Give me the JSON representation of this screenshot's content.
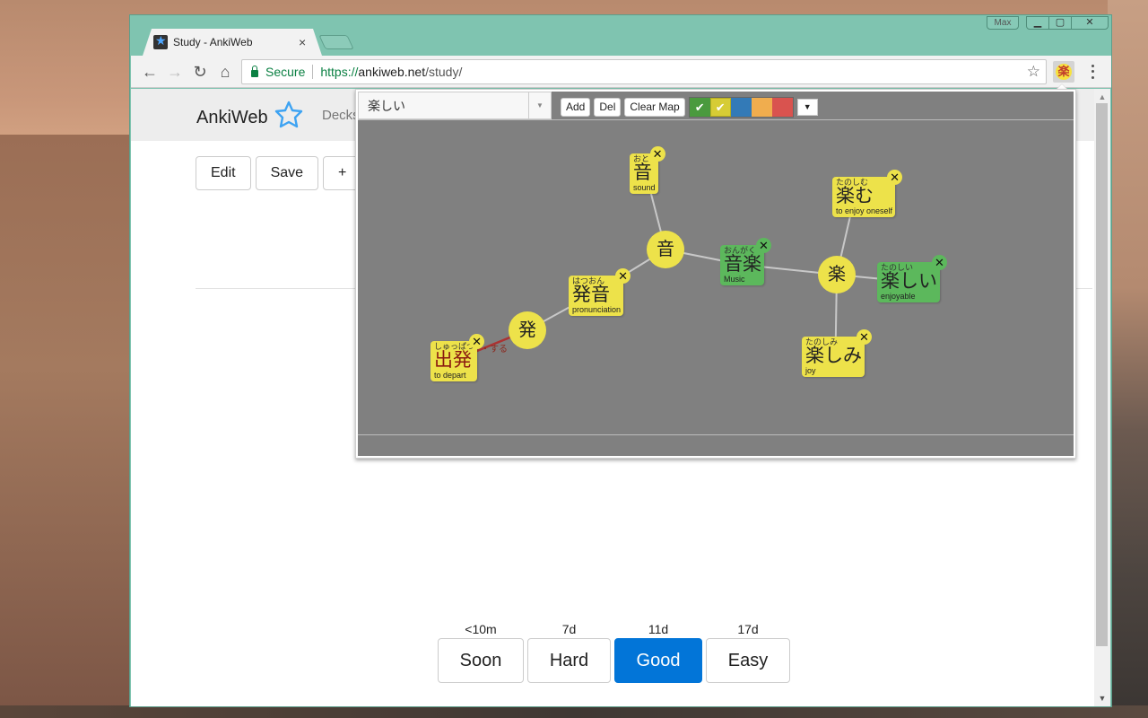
{
  "window": {
    "max_label": "Max",
    "controls": [
      "minimize",
      "restore",
      "close"
    ]
  },
  "tab": {
    "title": "Study - AnkiWeb",
    "close_glyph": "×"
  },
  "toolbar": {
    "back_glyph": "←",
    "forward_glyph": "→",
    "reload_glyph": "↻",
    "home_glyph": "⌂",
    "secure_label": "Secure",
    "url_scheme": "https://",
    "url_host": "ankiweb.net",
    "url_path": "/study/",
    "star_glyph": "☆",
    "extension_glyph": "楽"
  },
  "page": {
    "brand": "AnkiWeb",
    "brand_star": "✩",
    "nav_decks": "Decks",
    "edit_buttons": [
      "Edit",
      "Save",
      "+"
    ],
    "answers": [
      {
        "time": "<10m",
        "label": "Soon",
        "primary": false
      },
      {
        "time": "7d",
        "label": "Hard",
        "primary": false
      },
      {
        "time": "11d",
        "label": "Good",
        "primary": true
      },
      {
        "time": "17d",
        "label": "Easy",
        "primary": false
      }
    ]
  },
  "popup": {
    "selected_word": "楽しい",
    "select_arrow": "▼",
    "buttons": {
      "add": "Add",
      "del": "Del",
      "clear": "Clear Map"
    },
    "swatches": [
      {
        "color": "#4a9a3e",
        "checked": true,
        "name": "green"
      },
      {
        "color": "#d6cc35",
        "checked": true,
        "name": "yellow"
      },
      {
        "color": "#337ab7",
        "checked": false,
        "name": "blue"
      },
      {
        "color": "#f0ad4e",
        "checked": false,
        "name": "orange"
      },
      {
        "color": "#d9534f",
        "checked": false,
        "name": "red"
      }
    ],
    "check_glyph": "✔",
    "more_glyph": "▼",
    "map": {
      "hubs": [
        {
          "id": "oto",
          "kanji": "音"
        },
        {
          "id": "hatsu",
          "kanji": "発"
        },
        {
          "id": "raku",
          "kanji": "楽"
        }
      ],
      "cards": [
        {
          "id": "oto_card",
          "reading": "おと",
          "word": "音",
          "meaning": "sound",
          "color": "yellow"
        },
        {
          "id": "hatsuon",
          "reading": "はつおん",
          "word": "発音",
          "meaning": "pronunciation",
          "color": "yellow"
        },
        {
          "id": "shuppatsu",
          "reading": "しゅっぱつ",
          "word": "出発",
          "meaning": "to depart",
          "color": "yellow",
          "suffix": "・する",
          "highlight": "red"
        },
        {
          "id": "ongaku",
          "reading": "おんがく",
          "word": "音楽",
          "meaning": "Music",
          "color": "green"
        },
        {
          "id": "tanoshimu",
          "reading": "たのしむ",
          "word": "楽む",
          "meaning": "to enjoy oneself",
          "color": "yellow"
        },
        {
          "id": "tanoshii",
          "reading": "たのしい",
          "word": "楽しい",
          "meaning": "enjoyable",
          "color": "green"
        },
        {
          "id": "tanoshimi",
          "reading": "たのしみ",
          "word": "楽しみ",
          "meaning": "joy",
          "color": "yellow"
        }
      ],
      "close_glyph": "✕"
    }
  }
}
